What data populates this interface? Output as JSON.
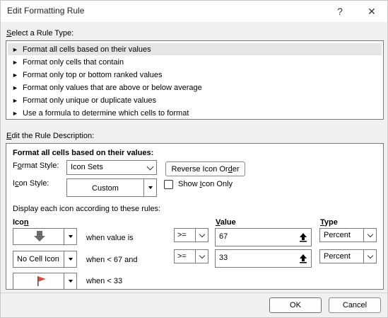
{
  "window": {
    "title": "Edit Formatting Rule",
    "help_glyph": "?",
    "close_glyph": "✕"
  },
  "rule_type": {
    "label_prefix": "S",
    "label_rest": "elect a Rule Type:",
    "items": [
      {
        "label": "Format all cells based on their values",
        "selected": true
      },
      {
        "label": "Format only cells that contain"
      },
      {
        "label": "Format only top or bottom ranked values"
      },
      {
        "label": "Format only values that are above or below average"
      },
      {
        "label": "Format only unique or duplicate values"
      },
      {
        "label": "Use a formula to determine which cells to format"
      }
    ]
  },
  "description": {
    "label_prefix": "E",
    "label_rest": "dit the Rule Description:",
    "heading": "Format all cells based on their values:",
    "format_style_label_a": "F",
    "format_style_label_b": "o",
    "format_style_label_c": "rmat Style:",
    "format_style_value": "Icon Sets",
    "reverse_button_a": "Reverse Icon Or",
    "reverse_button_b": "d",
    "reverse_button_c": "er",
    "icon_style_label_a": "I",
    "icon_style_label_b": "c",
    "icon_style_label_c": "on Style:",
    "icon_style_value": "Custom",
    "show_icon_only_a": "Show ",
    "show_icon_only_b": "I",
    "show_icon_only_c": "con Only",
    "show_icon_only_checked": false,
    "display_rules_text": "Display each icon according to these rules:",
    "col_icon_a": "Ico",
    "col_icon_b": "n",
    "col_value_a": "V",
    "col_value_b": "alue",
    "col_type_a": "T",
    "col_type_b": "ype",
    "rows": [
      {
        "icon_name": "gray-down-arrow-icon",
        "icon_text": "",
        "condition": "when value is",
        "operator": ">=",
        "value": "67",
        "type": "Percent"
      },
      {
        "icon_name": "no-cell-icon",
        "icon_text": "No Cell Icon",
        "condition": "when < 67 and",
        "operator": ">=",
        "value": "33",
        "type": "Percent"
      },
      {
        "icon_name": "red-flag-icon",
        "icon_text": "",
        "condition": "when < 33"
      }
    ]
  },
  "footer": {
    "ok_label": "OK",
    "cancel_label": "Cancel"
  },
  "colors": {
    "flag_red": "#e04a3a",
    "arrow_gray": "#6b6b6b",
    "selection": "#e5e5e5"
  }
}
